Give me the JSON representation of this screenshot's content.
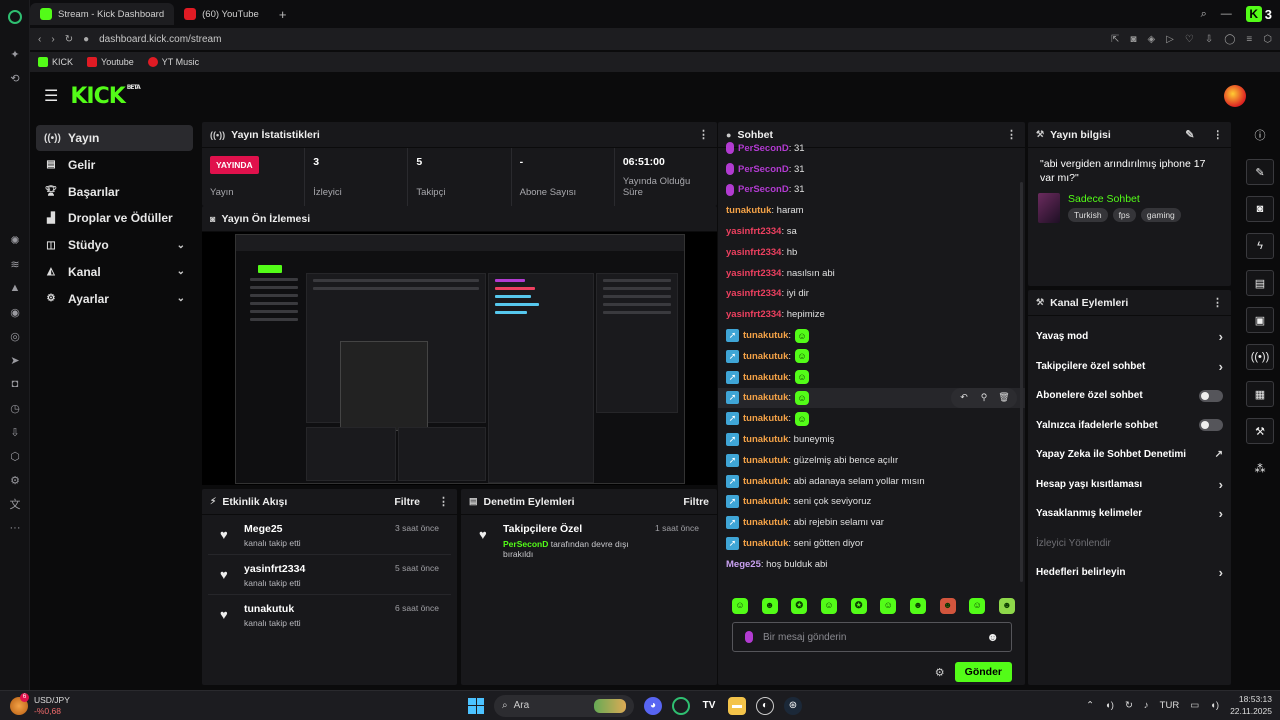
{
  "browser": {
    "tabs": [
      {
        "label": "Stream - Kick Dashboard",
        "active": true,
        "icon": "kick-favicon"
      },
      {
        "label": "(60) YouTube",
        "active": false,
        "icon": "youtube-favicon"
      }
    ],
    "url": "dashboard.kick.com/stream",
    "bookmarks": [
      "KICK",
      "Youtube",
      "YT Music"
    ],
    "ext_count": "3"
  },
  "header": {
    "logo": "KICK",
    "beta": "BETA"
  },
  "nav": [
    {
      "label": "Yayın",
      "icon": "broadcast-icon",
      "active": true,
      "chevron": false
    },
    {
      "label": "Gelir",
      "icon": "income-icon",
      "active": false,
      "chevron": false
    },
    {
      "label": "Başarılar",
      "icon": "trophy-icon",
      "active": false,
      "chevron": false
    },
    {
      "label": "Droplar ve Ödüller",
      "icon": "gift-icon",
      "active": false,
      "chevron": false
    },
    {
      "label": "Stüdyo",
      "icon": "studio-icon",
      "active": false,
      "chevron": true
    },
    {
      "label": "Kanal",
      "icon": "channel-icon",
      "active": false,
      "chevron": true
    },
    {
      "label": "Ayarlar",
      "icon": "gear-icon",
      "active": false,
      "chevron": true
    }
  ],
  "stats": {
    "title": "Yayın İstatistikleri",
    "live_badge": "YAYINDA",
    "live_label": "Yayın",
    "viewers_value": "3",
    "viewers_label": "İzleyici",
    "followers_value": "5",
    "followers_label": "Takipçi",
    "subs_value": "-",
    "subs_label": "Abone Sayısı",
    "duration_value": "06:51:00",
    "duration_label": "Yayında Olduğu Süre"
  },
  "preview": {
    "title": "Yayın Ön İzlemesi"
  },
  "activity": {
    "title": "Etkinlik Akışı",
    "filter": "Filtre",
    "items": [
      {
        "name": "Mege25",
        "sub": "kanalı takip etti",
        "time": "3 saat önce"
      },
      {
        "name": "yasinfrt2334",
        "sub": "kanalı takip etti",
        "time": "5 saat önce"
      },
      {
        "name": "tunakutuk",
        "sub": "kanalı takip etti",
        "time": "6 saat önce"
      }
    ]
  },
  "moderation": {
    "title": "Denetim Eylemleri",
    "filter": "Filtre",
    "item": {
      "name": "Takipçilere Özel",
      "time": "1 saat önce",
      "actor": "PerSeconD",
      "desc": " tarafından devre dışı bırakıldı"
    }
  },
  "chat": {
    "title": "Sohbet",
    "messages": [
      {
        "user": "PerSeconD",
        "color": "pur",
        "badge": "mic",
        "text": ": 31"
      },
      {
        "user": "PerSeconD",
        "color": "pur",
        "badge": "mic",
        "text": ": 31"
      },
      {
        "user": "PerSeconD",
        "color": "pur",
        "badge": "mic",
        "text": ": 31"
      },
      {
        "user": "tunakutuk",
        "color": "ora",
        "badge": "",
        "text": ": haram"
      },
      {
        "user": "yasinfrt2334",
        "color": "red",
        "badge": "",
        "text": ": sa"
      },
      {
        "user": "yasinfrt2334",
        "color": "red",
        "badge": "",
        "text": ": hb"
      },
      {
        "user": "yasinfrt2334",
        "color": "red",
        "badge": "",
        "text": ": nasılsın abi"
      },
      {
        "user": "yasinfrt2334",
        "color": "red",
        "badge": "",
        "text": ": iyi dir"
      },
      {
        "user": "yasinfrt2334",
        "color": "red",
        "badge": "",
        "text": ": hepimize"
      },
      {
        "user": "tunakutuk",
        "color": "ora",
        "badge": "verified",
        "text": ":",
        "emote": true
      },
      {
        "user": "tunakutuk",
        "color": "ora",
        "badge": "verified",
        "text": ":",
        "emote": true
      },
      {
        "user": "tunakutuk",
        "color": "ora",
        "badge": "verified",
        "text": ":",
        "emote": true
      },
      {
        "user": "tunakutuk",
        "color": "ora",
        "badge": "verified",
        "text": ":",
        "emote": true,
        "hl": true
      },
      {
        "user": "tunakutuk",
        "color": "ora",
        "badge": "verified",
        "text": ":",
        "emote": true
      },
      {
        "user": "tunakutuk",
        "color": "ora",
        "badge": "verified",
        "text": ": buneymiş"
      },
      {
        "user": "tunakutuk",
        "color": "ora",
        "badge": "verified",
        "text": ": güzelmiş abi bence açılır"
      },
      {
        "user": "tunakutuk",
        "color": "ora",
        "badge": "verified",
        "text": ": abi adanaya selam yollar mısın"
      },
      {
        "user": "tunakutuk",
        "color": "ora",
        "badge": "verified",
        "text": ": seni çok seviyoruz"
      },
      {
        "user": "tunakutuk",
        "color": "ora",
        "badge": "verified",
        "text": ": abi rejebin selamı var"
      },
      {
        "user": "tunakutuk",
        "color": "ora",
        "badge": "verified",
        "text": ": seni götten diyor"
      },
      {
        "user": "Mege25",
        "color": "lav",
        "badge": "",
        "text": ": hoş bulduk abi"
      }
    ],
    "input_placeholder": "Bir mesaj gönderin",
    "send_label": "Gönder"
  },
  "info": {
    "title": "Yayın bilgisi",
    "stream_title": "\"abi vergiden arındırılmış iphone 17 var mı?\"",
    "category": "Sadece Sohbet",
    "tags": [
      "Turkish",
      "fps",
      "gaming"
    ]
  },
  "channel_actions": {
    "title": "Kanal Eylemleri",
    "items": [
      {
        "label": "Yavaş mod",
        "type": "arrow"
      },
      {
        "label": "Takipçilere özel sohbet",
        "type": "arrow"
      },
      {
        "label": "Abonelere özel sohbet",
        "type": "toggle",
        "on": false
      },
      {
        "label": "Yalnızca ifadelerle sohbet",
        "type": "toggle",
        "on": false
      },
      {
        "label": "Yapay Zeka ile Sohbet Denetimi",
        "type": "external"
      },
      {
        "label": "Hesap yaşı kısıtlaması",
        "type": "arrow"
      },
      {
        "label": "Yasaklanmış kelimeler",
        "type": "arrow"
      },
      {
        "label": "İzleyici Yönlendir",
        "type": "disabled"
      },
      {
        "label": "Hedefleri belirleyin",
        "type": "arrow"
      }
    ]
  },
  "taskbar": {
    "ticker_name": "USD/JPY",
    "ticker_value": "-%0,68",
    "ticker_badge": "6",
    "search_label": "Ara",
    "lang": "TUR",
    "time": "18:53:13",
    "date": "22.11.2025"
  },
  "colors": {
    "kick_green": "#53fc18",
    "live_red": "#e0114c",
    "panel_bg": "#18181b"
  }
}
